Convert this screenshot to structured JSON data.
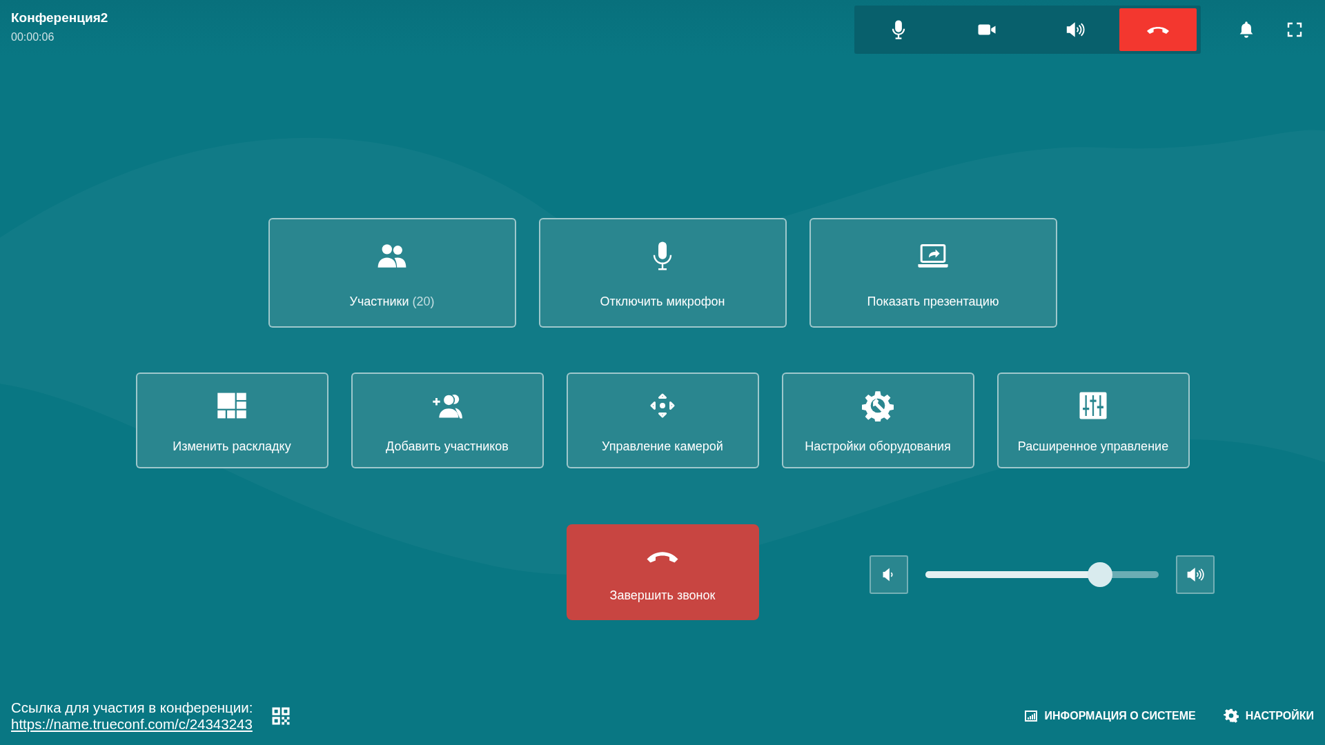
{
  "header": {
    "title": "Конференция2",
    "timer": "00:00:06"
  },
  "toolbar": [
    {
      "kind": "mic"
    },
    {
      "kind": "camera"
    },
    {
      "kind": "speaker"
    },
    {
      "kind": "hangup"
    }
  ],
  "tiles_top": [
    {
      "kind": "people",
      "label": "Участники",
      "count": "(20)"
    },
    {
      "kind": "mic",
      "label": "Отключить микрофон"
    },
    {
      "kind": "share",
      "label": "Показать презентацию"
    }
  ],
  "tiles_bottom": [
    {
      "kind": "layout",
      "label": "Изменить раскладку"
    },
    {
      "kind": "add-user",
      "label": "Добавить участников"
    },
    {
      "kind": "camera-control",
      "label": "Управление камерой"
    },
    {
      "kind": "gear",
      "label": "Настройки оборудования"
    },
    {
      "kind": "sliders",
      "label": "Расширенное управление"
    }
  ],
  "end_call": {
    "label": "Завершить звонок"
  },
  "volume": {
    "level": 0.75
  },
  "footer": {
    "link_caption": "Ссылка для участия в конференции:",
    "link": "https://name.trueconf.com/c/24343243",
    "system_info": "ИНФОРМАЦИЯ О СИСТЕМЕ",
    "settings": "НАСТРОЙКИ"
  }
}
